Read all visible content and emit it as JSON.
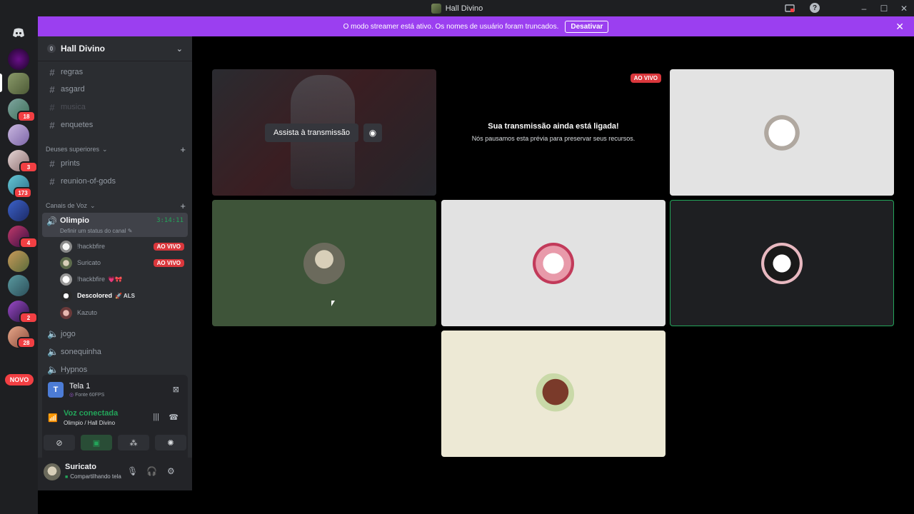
{
  "window": {
    "title": "Hall Divino"
  },
  "banner": {
    "message": "O modo streamer está ativo. Os nomes de usuário foram truncados.",
    "button_label": "Desativar"
  },
  "server_rail": {
    "badges": [
      "18",
      "3",
      "173",
      "4",
      "2",
      "28"
    ],
    "novo_label": "NOVO"
  },
  "guild": {
    "name": "Hall Divino",
    "boost_level": "0"
  },
  "channels": {
    "top": [
      {
        "name": "regras"
      },
      {
        "name": "asgard"
      },
      {
        "name": "musica"
      },
      {
        "name": "enquetes"
      }
    ],
    "category_1": {
      "label": "Deuses superiores",
      "channels": [
        "prints",
        "reunion-of-gods"
      ]
    },
    "category_2": {
      "label": "Canais de Voz",
      "active_voice": {
        "name": "Olimpio",
        "timer": "3:14:11",
        "status": "Definir um status do canal"
      },
      "users": [
        {
          "name": "!hackbfire",
          "live": "AO VIVO"
        },
        {
          "name": "Suricato",
          "live": "AO VIVO"
        },
        {
          "name": "!hackbfire",
          "tag": "💗🎀"
        },
        {
          "name": "Descolored",
          "tag": "🚀 ALS"
        },
        {
          "name": "Kazuto"
        }
      ],
      "other_voice": [
        "jogo",
        "sonequinha",
        "Hypnos"
      ]
    }
  },
  "panel": {
    "stream_title": "Tela 1",
    "stream_source": "Fonte 60FPS",
    "voice_status": "Voz conectada",
    "voice_location": "Olimpio / Hall Divino"
  },
  "user": {
    "name": "Suricato",
    "status": "Compartilhando tela"
  },
  "stage": {
    "live_label": "AO VIVO",
    "watch_label": "Assista à transmissão",
    "paused_title": "Sua transmissão ainda está ligada!",
    "paused_subtitle": "Nós pausamos esta prévia para preservar seus recursos."
  },
  "colors": {
    "brand_purple": "#9b3ff0",
    "live_red": "#da373c",
    "voice_green": "#23a55a",
    "tile_green": "#3e5439",
    "tile_light": "#e3e3e3",
    "tile_cream": "#ede9d5",
    "tile_dark": "#1e1f22"
  }
}
